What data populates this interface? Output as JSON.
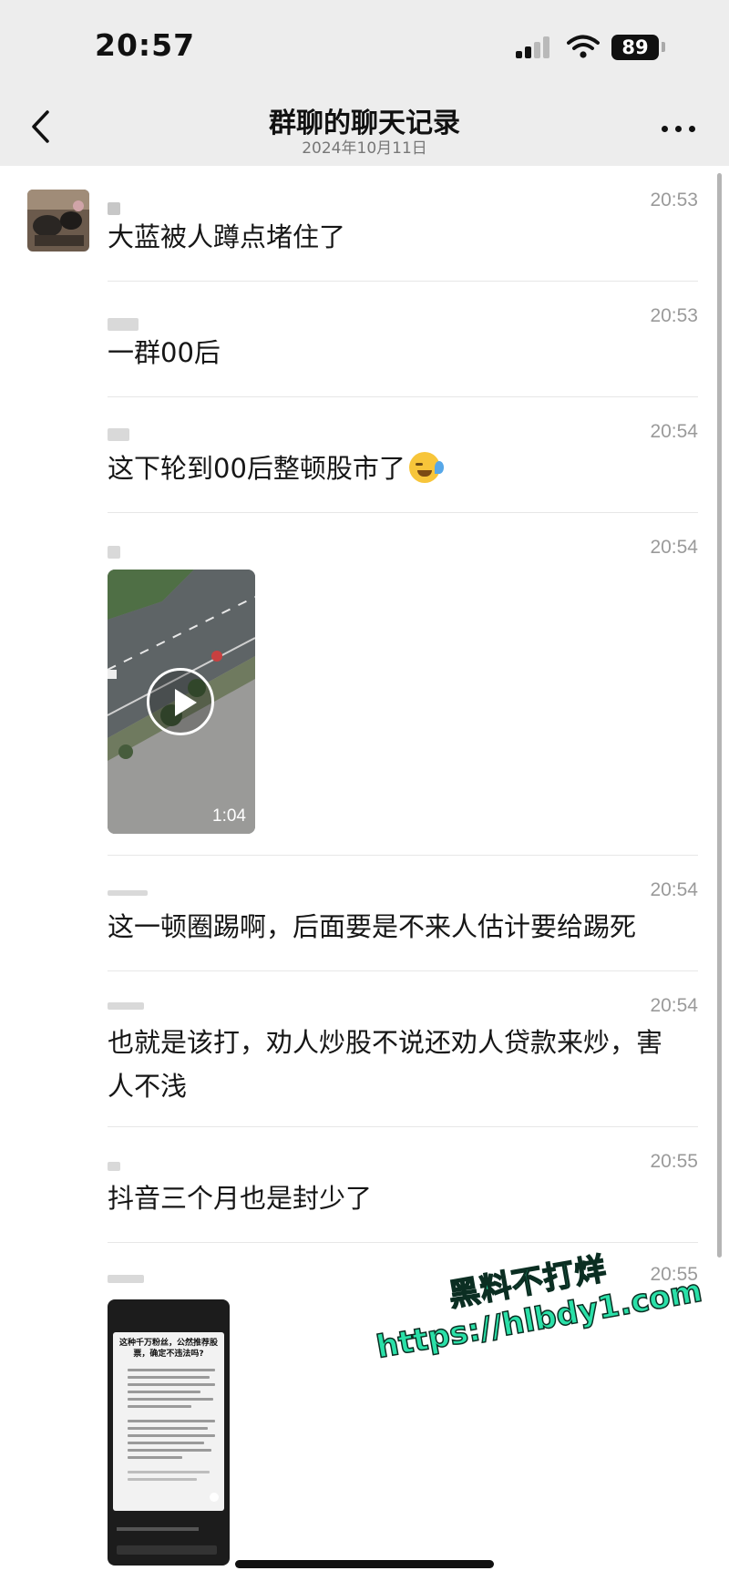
{
  "status_bar": {
    "time": "20:57",
    "battery": "89",
    "icons": [
      "signal-icon",
      "wifi-icon",
      "battery-icon"
    ]
  },
  "nav": {
    "title": "群聊的聊天记录",
    "date": "2024年10月11日",
    "icons": [
      "back-chevron-icon",
      "more-icon"
    ]
  },
  "messages": [
    {
      "time": "20:53",
      "text": "大蓝被人蹲点堵住了"
    },
    {
      "time": "20:53",
      "text": "一群00后"
    },
    {
      "time": "20:54",
      "text": "这下轮到00后整顿股市了",
      "emoji": "crying-laughing-emoji"
    },
    {
      "time": "20:54",
      "video_duration": "1:04"
    },
    {
      "time": "20:54",
      "text": "这一顿圈踢啊，后面要是不来人估计要给踢死"
    },
    {
      "time": "20:54",
      "text_line1": "也就是该打，劝人炒股不说还劝人贷款来炒，害",
      "text_line2": "人不浅"
    },
    {
      "time": "20:55",
      "text": "抖音三个月也是封少了"
    },
    {
      "time": "20:55",
      "screenshot_title": "这种千万粉丝，公然推荐股票，确定不违法吗?"
    }
  ],
  "watermark": {
    "title": "黑料不打烊",
    "url": "https://hlbdy1.com"
  },
  "colors": {
    "header_bg": "#ededed",
    "watermark": "#2ae0a8",
    "time_text": "#9a9a9a"
  }
}
